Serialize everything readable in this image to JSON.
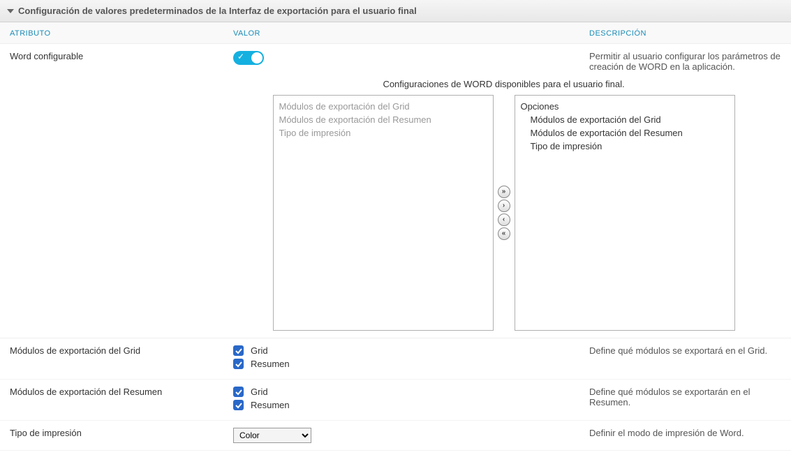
{
  "panel": {
    "title": "Configuración de valores predeterminados de la Interfaz de exportación para el usuario final"
  },
  "columns": {
    "attr": "ATRIBUTO",
    "val": "VALOR",
    "desc": "DESCRIPCIÓN"
  },
  "row_word_configurable": {
    "attr": "Word configurable",
    "desc": "Permitir al usuario configurar los parámetros de creación de WORD en la aplicación."
  },
  "dual_list": {
    "title": "Configuraciones de WORD disponibles para el usuario final.",
    "left": {
      "items": [
        "Módulos de exportación del Grid",
        "Módulos de exportación del Resumen",
        "Tipo de impresión"
      ]
    },
    "right": {
      "group_label": "Opciones",
      "items": [
        "Módulos de exportación del Grid",
        "Módulos de exportación del Resumen",
        "Tipo de impresión"
      ]
    },
    "btn_all_right": "»",
    "btn_right": "›",
    "btn_left": "‹",
    "btn_all_left": "«"
  },
  "row_grid_modules": {
    "attr": "Módulos de exportación del Grid",
    "opts": {
      "grid": "Grid",
      "resumen": "Resumen"
    },
    "desc": "Define qué módulos se exportará en el Grid."
  },
  "row_summary_modules": {
    "attr": "Módulos de exportación del Resumen",
    "opts": {
      "grid": "Grid",
      "resumen": "Resumen"
    },
    "desc": "Define qué módulos se exportarán en el Resumen."
  },
  "row_print_type": {
    "attr": "Tipo de impresión",
    "selected": "Color",
    "desc": "Definir el modo de impresión de Word."
  }
}
